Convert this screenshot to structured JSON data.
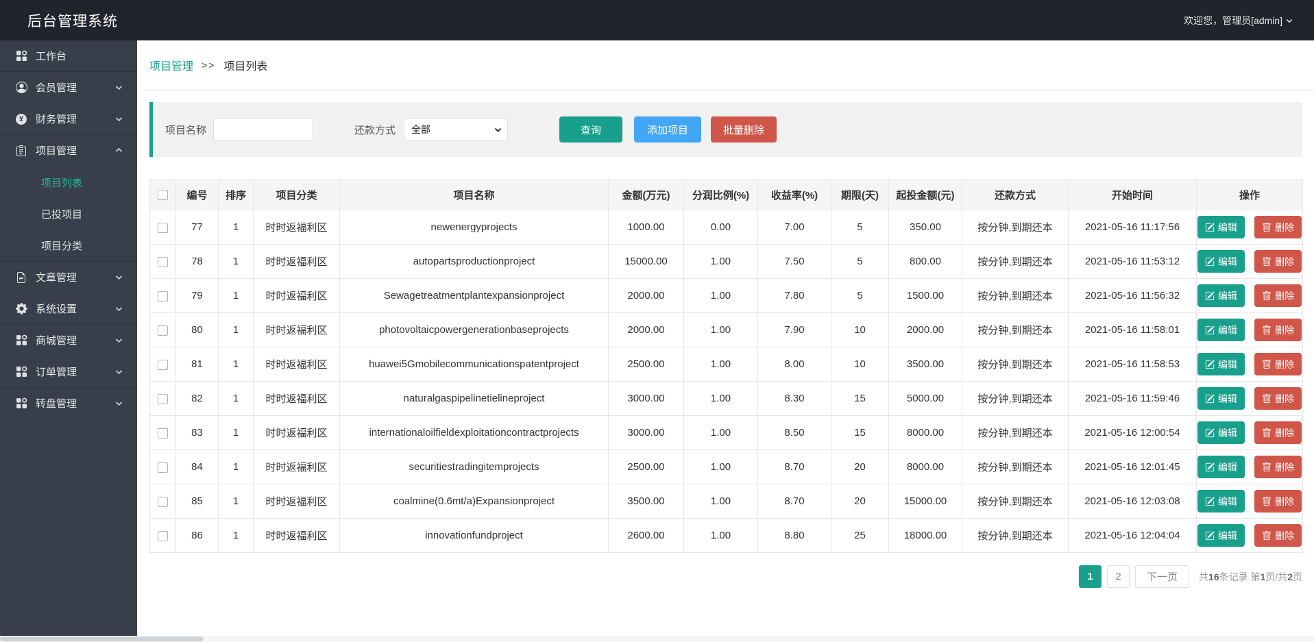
{
  "colors": {
    "accent_teal": "#18a08c",
    "accent_blue": "#41a6f5",
    "accent_red": "#d0564a",
    "topbar_bg": "#21242d",
    "sidebar_bg": "#383f4a",
    "active_submenu": "#1fbc9c"
  },
  "header": {
    "title": "后台管理系统",
    "welcome": "欢迎您，管理员[admin]"
  },
  "sidebar": {
    "items": [
      {
        "key": "workbench",
        "label": "工作台",
        "icon": "grid-icon",
        "expandable": false
      },
      {
        "key": "member",
        "label": "会员管理",
        "icon": "person-circle-icon",
        "expandable": true
      },
      {
        "key": "finance",
        "label": "财务管理",
        "icon": "yuan-circle-icon",
        "expandable": true
      },
      {
        "key": "project",
        "label": "项目管理",
        "icon": "clipboard-icon",
        "expandable": true,
        "expanded": true,
        "children": [
          {
            "label": "项目列表",
            "active": true
          },
          {
            "label": "已投项目",
            "active": false
          },
          {
            "label": "项目分类",
            "active": false
          }
        ]
      },
      {
        "key": "article",
        "label": "文章管理",
        "icon": "document-icon",
        "expandable": true
      },
      {
        "key": "settings",
        "label": "系统设置",
        "icon": "gear-icon",
        "expandable": true
      },
      {
        "key": "mall",
        "label": "商城管理",
        "icon": "grid-icon",
        "expandable": true
      },
      {
        "key": "order",
        "label": "订单管理",
        "icon": "grid-icon",
        "expandable": true
      },
      {
        "key": "wheel",
        "label": "转盘管理",
        "icon": "grid-icon",
        "expandable": true
      }
    ]
  },
  "breadcrumb": {
    "parent": "项目管理",
    "separator": ">>",
    "current": "项目列表"
  },
  "filter": {
    "name_label": "项目名称",
    "name_value": "",
    "repay_label": "还款方式",
    "repay_selected": "全部",
    "query_button": "查询",
    "add_button": "添加项目",
    "batch_delete_button": "批量删除"
  },
  "table": {
    "columns": [
      "编号",
      "排序",
      "项目分类",
      "项目名称",
      "金额(万元)",
      "分润比例(%)",
      "收益率(%)",
      "期限(天)",
      "起投金额(元)",
      "还款方式",
      "开始时间",
      "操作"
    ],
    "edit_label": "编辑",
    "delete_label": "删除",
    "rows": [
      {
        "id": "77",
        "sort": "1",
        "category": "时时返福利区",
        "name": "newenergyprojects",
        "amount": "1000.00",
        "ratio": "0.00",
        "yield": "7.00",
        "term": "5",
        "min_invest": "350.00",
        "repay": "按分钟,到期还本",
        "start": "2021-05-16 11:17:56"
      },
      {
        "id": "78",
        "sort": "1",
        "category": "时时返福利区",
        "name": "autopartsproductionproject",
        "amount": "15000.00",
        "ratio": "1.00",
        "yield": "7.50",
        "term": "5",
        "min_invest": "800.00",
        "repay": "按分钟,到期还本",
        "start": "2021-05-16 11:53:12"
      },
      {
        "id": "79",
        "sort": "1",
        "category": "时时返福利区",
        "name": "Sewagetreatmentplantexpansionproject",
        "amount": "2000.00",
        "ratio": "1.00",
        "yield": "7.80",
        "term": "5",
        "min_invest": "1500.00",
        "repay": "按分钟,到期还本",
        "start": "2021-05-16 11:56:32"
      },
      {
        "id": "80",
        "sort": "1",
        "category": "时时返福利区",
        "name": "photovoltaicpowergenerationbaseprojects",
        "amount": "2000.00",
        "ratio": "1.00",
        "yield": "7.90",
        "term": "10",
        "min_invest": "2000.00",
        "repay": "按分钟,到期还本",
        "start": "2021-05-16 11:58:01"
      },
      {
        "id": "81",
        "sort": "1",
        "category": "时时返福利区",
        "name": "huawei5Gmobilecommunicationspatentproject",
        "amount": "2500.00",
        "ratio": "1.00",
        "yield": "8.00",
        "term": "10",
        "min_invest": "3500.00",
        "repay": "按分钟,到期还本",
        "start": "2021-05-16 11:58:53"
      },
      {
        "id": "82",
        "sort": "1",
        "category": "时时返福利区",
        "name": "naturalgaspipelinetielineproject",
        "amount": "3000.00",
        "ratio": "1.00",
        "yield": "8.30",
        "term": "15",
        "min_invest": "5000.00",
        "repay": "按分钟,到期还本",
        "start": "2021-05-16 11:59:46"
      },
      {
        "id": "83",
        "sort": "1",
        "category": "时时返福利区",
        "name": "internationaloilfieldexploitationcontractprojects",
        "amount": "3000.00",
        "ratio": "1.00",
        "yield": "8.50",
        "term": "15",
        "min_invest": "8000.00",
        "repay": "按分钟,到期还本",
        "start": "2021-05-16 12:00:54"
      },
      {
        "id": "84",
        "sort": "1",
        "category": "时时返福利区",
        "name": "securitiestradingitemprojects",
        "amount": "2500.00",
        "ratio": "1.00",
        "yield": "8.70",
        "term": "20",
        "min_invest": "8000.00",
        "repay": "按分钟,到期还本",
        "start": "2021-05-16 12:01:45"
      },
      {
        "id": "85",
        "sort": "1",
        "category": "时时返福利区",
        "name": "coalmine(0.6mt/a)Expansionproject",
        "amount": "3500.00",
        "ratio": "1.00",
        "yield": "8.70",
        "term": "20",
        "min_invest": "15000.00",
        "repay": "按分钟,到期还本",
        "start": "2021-05-16 12:03:08"
      },
      {
        "id": "86",
        "sort": "1",
        "category": "时时返福利区",
        "name": "innovationfundproject",
        "amount": "2600.00",
        "ratio": "1.00",
        "yield": "8.80",
        "term": "25",
        "min_invest": "18000.00",
        "repay": "按分钟,到期还本",
        "start": "2021-05-16 12:04:04"
      }
    ]
  },
  "pagination": {
    "pages": [
      {
        "label": "1",
        "active": true
      },
      {
        "label": "2",
        "active": false
      }
    ],
    "next_label": "下一页",
    "summary_parts": [
      {
        "text": "共",
        "bold": false
      },
      {
        "text": "16",
        "bold": true
      },
      {
        "text": "条记录 第",
        "bold": false
      },
      {
        "text": "1",
        "bold": true
      },
      {
        "text": "页/共",
        "bold": false
      },
      {
        "text": "2",
        "bold": true
      },
      {
        "text": "页",
        "bold": false
      }
    ]
  }
}
